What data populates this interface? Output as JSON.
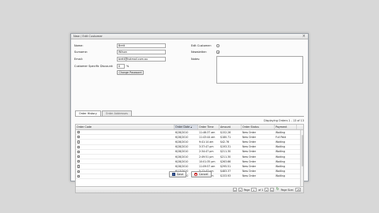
{
  "window": {
    "title": "New / Edit Customer",
    "close": "×"
  },
  "form": {
    "name_label": "Name:",
    "name_value": "Brett",
    "surname_label": "Surname:",
    "surname_value": "Wilson",
    "email_label": "Email:",
    "email_value": "brett@hotmail.com.au",
    "discount_label": "Customer Specific Discount:",
    "discount_value": "0",
    "discount_unit": "%",
    "change_password": "Change Password",
    "edit_customer_label": "Edit Customer:",
    "newsletter_label": "Newsletter:",
    "notes_label": "Notes:"
  },
  "tabs": [
    {
      "label": "Order History",
      "active": true
    },
    {
      "label": "Order Addresses",
      "active": false
    }
  ],
  "displaying": "Displaying Orders 1 - 13 of 13",
  "grid": {
    "headers": [
      "Order Code",
      "Order Date ▴",
      "Order Time",
      "Amount",
      "Order Status",
      "Payment"
    ],
    "rows": [
      [
        "6/28/2010",
        "11:46:37 am",
        "$152.26",
        "New Order",
        "Waiting"
      ],
      [
        "6/28/2010",
        "11:43:44 am",
        "$180.71",
        "New Order",
        "Full Paid"
      ],
      [
        "6/28/2010",
        "9:41:14 am",
        "$42.76",
        "New Order",
        "Waiting"
      ],
      [
        "6/28/2010",
        "3:37:47 pm",
        "$193.31",
        "New Order",
        "Waiting"
      ],
      [
        "6/28/2010",
        "2:34:47 pm",
        "$211.30",
        "New Order",
        "Waiting"
      ],
      [
        "6/28/2010",
        "2:49:51 pm",
        "$211.30",
        "New Order",
        "Waiting"
      ],
      [
        "6/28/2010",
        "10:01:35 pm",
        "$263.66",
        "New Order",
        "Waiting"
      ],
      [
        "6/28/2010",
        "11:09:57 am",
        "$295.51",
        "New Order",
        "Waiting"
      ],
      [
        "6/17/2010",
        "5:12:47 pm",
        "$483.37",
        "New Order",
        "Waiting"
      ],
      [
        "6/17/2010",
        "2:10:52 pm",
        "$153.93",
        "New Order",
        "Waiting"
      ]
    ]
  },
  "pager": {
    "page_label": "Page",
    "page_value": "1",
    "of_label": "of 1",
    "size_label": "Page Size:",
    "size_value": "25"
  },
  "footer": {
    "save": "Save",
    "cancel": "Cancel"
  }
}
